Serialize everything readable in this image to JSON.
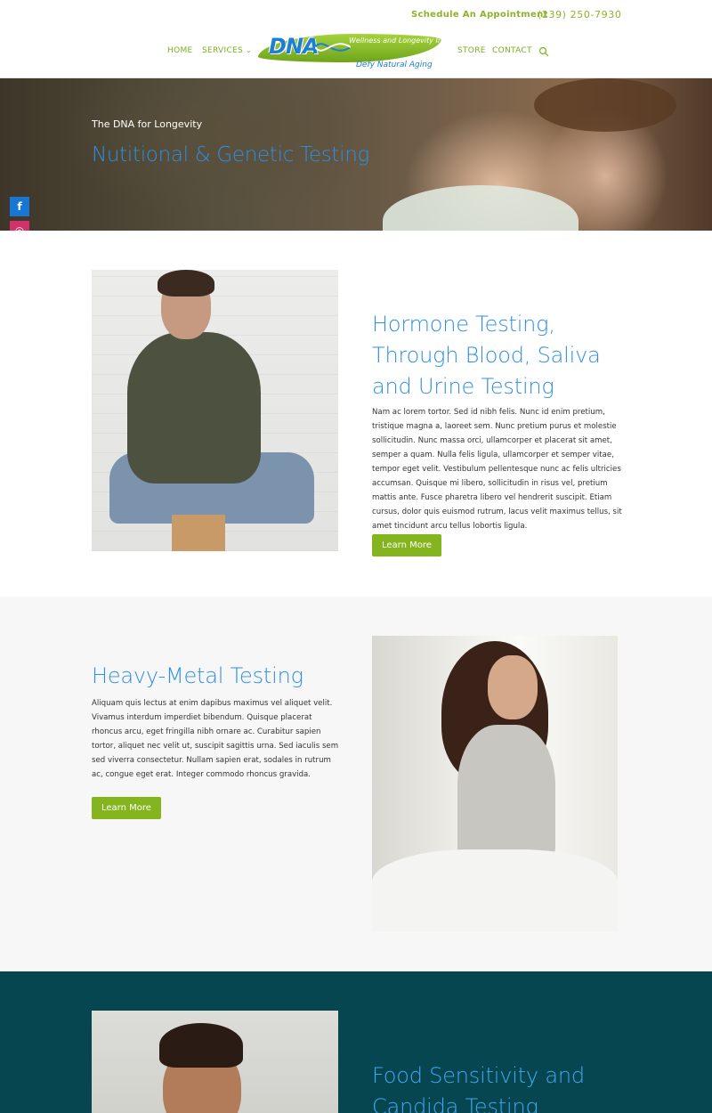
{
  "topbar": {
    "appointment": "Schedule An Appointment",
    "phone": "(239) 250-7930"
  },
  "nav": {
    "home": "HOME",
    "services": "SERVICES",
    "store": "STORE",
    "contact": "CONTACT"
  },
  "logo": {
    "letters": "DNA",
    "institute": "Wellness and Longevity Institute",
    "tagline": "Defy Natural Aging"
  },
  "hero": {
    "eyebrow": "The DNA for Longevity",
    "title": "Nutitional & Genetic Testing"
  },
  "social": {
    "facebook": "f",
    "instagram": "◎",
    "youtube": "▶"
  },
  "sections": [
    {
      "heading": "Hormone Testing, Through Blood, Saliva and Urine Testing",
      "body": "Nam ac lorem tortor. Sed id nibh felis. Nunc id enim pretium, tristique magna a, laoreet sem. Nunc pretium purus et molestie sollicitudin. Nunc massa orci, ullamcorper et placerat sit amet, semper a quam. Nulla felis ligula, ullamcorper et semper vitae, tempor eget velit. Vestibulum pellentesque nunc ac felis ultricies accumsan. Quisque mi libero, sollicitudin in risus vel, pretium mattis ante. Fusce pharetra libero vel hendrerit suscipit. Etiam cursus, dolor quis euismod rutrum, lacus velit maximus tellus, sit amet tincidunt arcu tellus lobortis ligula.",
      "button": "Learn More"
    },
    {
      "heading": "Heavy-Metal Testing",
      "body": "Aliquam quis lectus at enim dapibus maximus vel aliquet velit. Vivamus interdum imperdiet bibendum. Quisque placerat rhoncus arcu, eget fringilla nibh ornare ac. Curabitur sapien tortor, aliquet nec velit ut, suscipit sagittis urna. Sed iaculis sem sed viverra consectetur. Nullam sapien erat, sodales in rutrum ac, congue eget erat. Integer commodo rhoncus gravida.",
      "button": "Learn More"
    },
    {
      "heading": "Food Sensitivity and Candida Testing"
    }
  ],
  "colors": {
    "accent_green": "#84b51f",
    "heading_blue": "#2f8fe0",
    "dark_teal": "#054651"
  }
}
